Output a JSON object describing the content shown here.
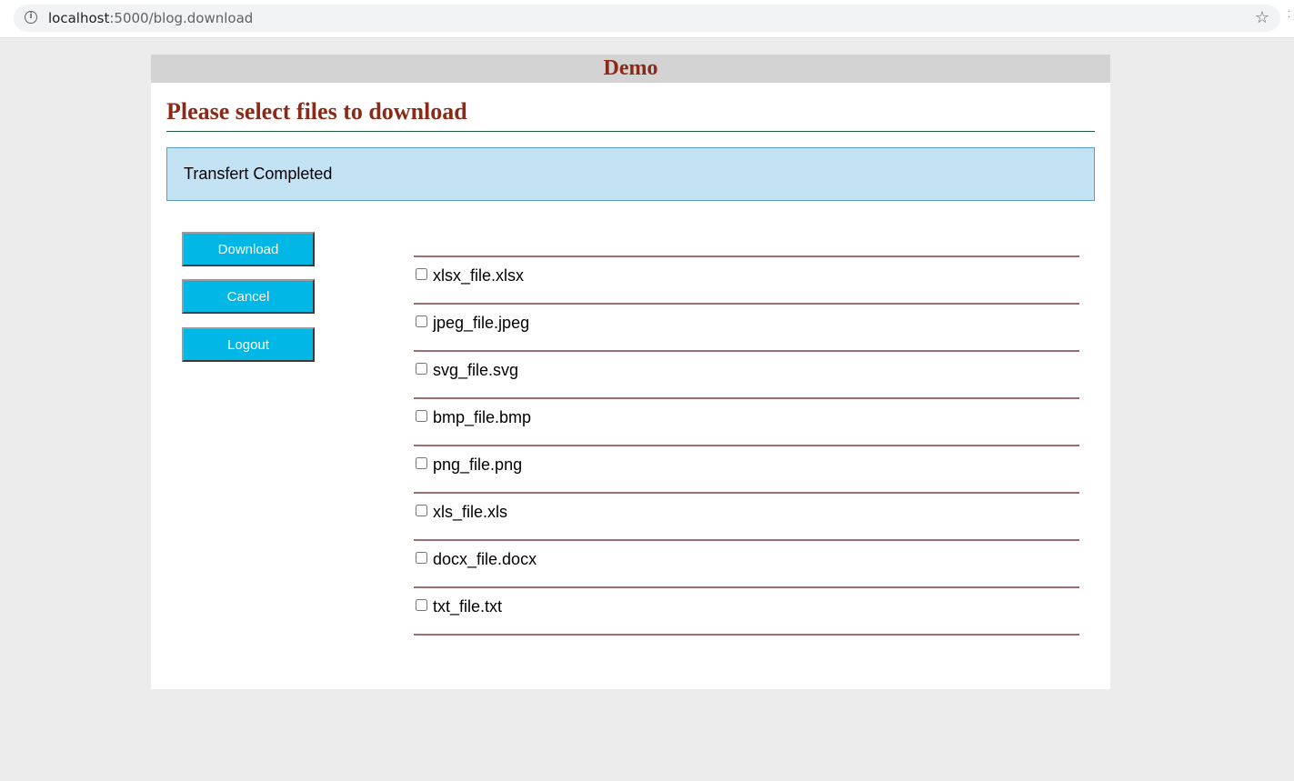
{
  "browser": {
    "url_host": "localhost",
    "url_rest": ":5000/blog.download"
  },
  "header": {
    "title": "Demo"
  },
  "main": {
    "heading": "Please select files to download",
    "alert": "Transfert Completed",
    "buttons": {
      "download": "Download",
      "cancel": "Cancel",
      "logout": "Logout"
    },
    "files": [
      "xlsx_file.xlsx",
      "jpeg_file.jpeg",
      "svg_file.svg",
      "bmp_file.bmp",
      "png_file.png",
      "xls_file.xls",
      "docx_file.docx",
      "txt_file.txt"
    ]
  },
  "colors": {
    "accent_text": "#8b2a17",
    "button_bg": "#00b7e6",
    "alert_bg": "#c3e3f5"
  }
}
